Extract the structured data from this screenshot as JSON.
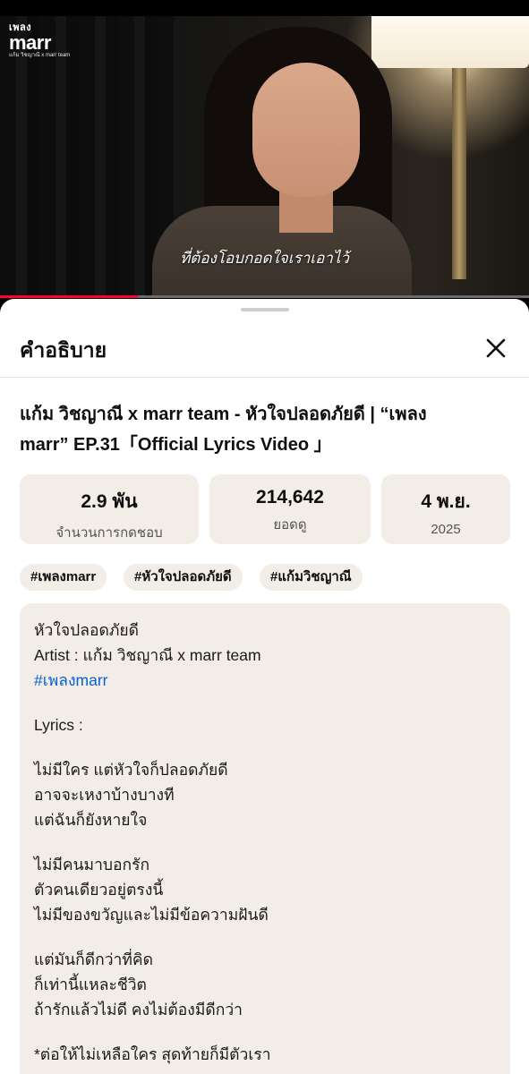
{
  "video": {
    "logo_line1": "เพลง",
    "logo_line2": "marr",
    "logo_line3": "แก้ม วิชญาณี x marr team",
    "subtitle": "ที่ต้องโอบกอดใจเราเอาไว้",
    "progress_fraction": 0.26
  },
  "sheet": {
    "title": "คำอธิบาย",
    "video_title_line1": "แก้ม วิชญาณี x marr team - หัวใจปลอดภัยดี | “เพลง",
    "video_title_line2": "marr” EP.31「Official  Lyrics Video 」"
  },
  "stats": {
    "likes_value": "2.9 พัน",
    "likes_label": "จำนวนการกดชอบ",
    "views_value": "214,642",
    "views_label": "ยอดดู",
    "date_value": "4 พ.ย.",
    "date_label": "2025"
  },
  "tags": [
    "#เพลงmarr",
    "#หัวใจปลอดภัยดี",
    "#แก้มวิชญาณี"
  ],
  "description": {
    "song_title": "หัวใจปลอดภัยดี",
    "artist": "Artist :  แก้ม วิชญาณี x marr team",
    "hashtag": "#เพลงmarr",
    "lyrics_label": "Lyrics :",
    "verse1": [
      "ไม่มีใคร แต่หัวใจก็ปลอดภัยดี",
      "อาจจะเหงาบ้างบางที",
      "แต่ฉันก็ยังหายใจ"
    ],
    "verse2": [
      "ไม่มีคนมาบอกรัก",
      "ตัวคนเดียวอยู่ตรงนี้",
      "ไม่มีของขวัญและไม่มีข้อความฝันดี"
    ],
    "verse3": [
      "แต่มันก็ดีกว่าที่คิด",
      "ก็เท่านี้แหละชีวิต",
      "ถ้ารักแล้วไม่ดี คงไม่ต้องมีดีกว่า"
    ],
    "verse4": [
      "*ต่อให้ไม่เหลือใคร สุดท้ายก็มีตัวเรา"
    ]
  },
  "colors": {
    "progress": "#ff0033",
    "card_bg": "#f2ede6",
    "link": "#065fd4"
  }
}
